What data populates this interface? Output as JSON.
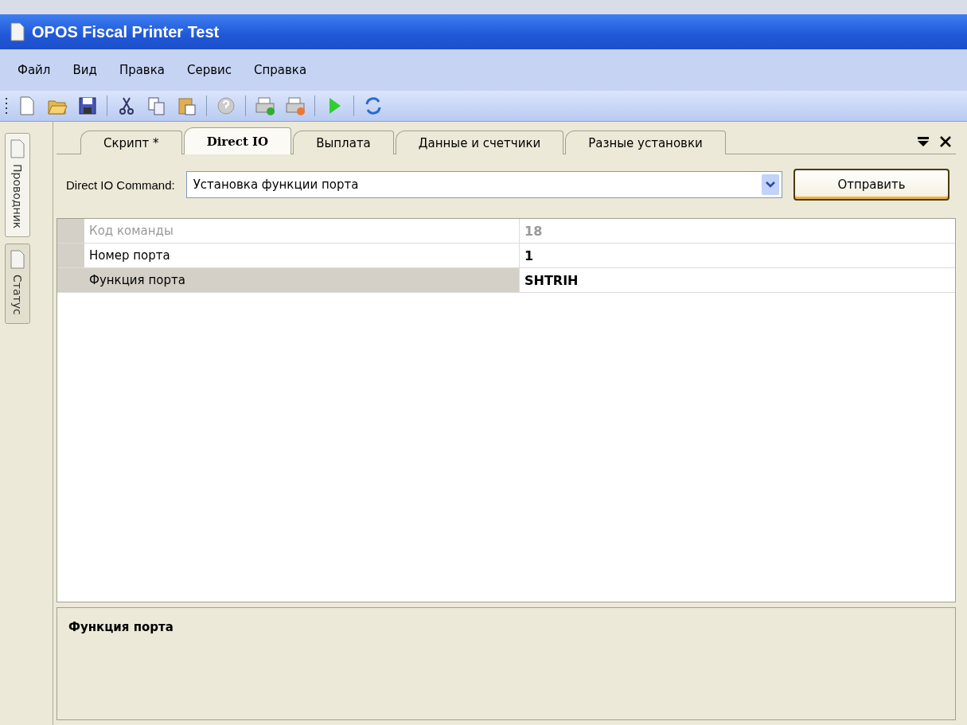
{
  "window": {
    "title": "OPOS Fiscal Printer Test"
  },
  "menu": [
    "Файл",
    "Вид",
    "Правка",
    "Сервис",
    "Справка"
  ],
  "side_tabs": [
    {
      "label": "Проводник",
      "selected": true
    },
    {
      "label": "Статус",
      "selected": false
    }
  ],
  "tabs": [
    {
      "label": "Скрипт *",
      "selected": false
    },
    {
      "label": "Direct IO",
      "selected": true
    },
    {
      "label": "Выплата",
      "selected": false
    },
    {
      "label": "Данные и счетчики",
      "selected": false
    },
    {
      "label": "Разные установки",
      "selected": false
    }
  ],
  "command": {
    "label": "Direct IO Command:",
    "value": "Установка функции порта",
    "button": "Отправить"
  },
  "properties": [
    {
      "name": "Код команды",
      "value": "18",
      "disabled": true,
      "selected": false
    },
    {
      "name": "Номер порта",
      "value": "1",
      "disabled": false,
      "selected": false
    },
    {
      "name": "Функция порта",
      "value": "SHTRIH",
      "disabled": false,
      "selected": true
    }
  ],
  "description": {
    "title": "Функция порта"
  }
}
